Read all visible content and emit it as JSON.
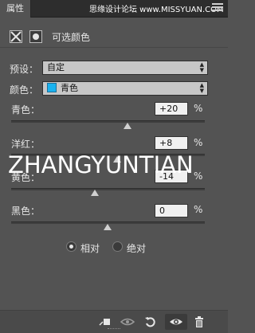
{
  "tab": {
    "label": "属性"
  },
  "watermark_top": "思缘设计论坛 www.MISSYUAN.COM",
  "adjustment": {
    "title": "可选颜色",
    "mask_icon": "layer-mask-icon",
    "type_icon": "selective-color-icon"
  },
  "preset": {
    "label": "预设：",
    "value": "自定"
  },
  "colors": {
    "label": "颜色：",
    "value": "青色",
    "swatch_color": "#19b2ef"
  },
  "sliders": [
    {
      "label": "青色：",
      "value": "+20",
      "unit": "%",
      "level": 20
    },
    {
      "label": "洋红：",
      "value": "+8",
      "unit": "%",
      "level": 8
    },
    {
      "label": "黄色：",
      "value": "-14",
      "unit": "%",
      "level": -14
    },
    {
      "label": "黑色：",
      "value": "0",
      "unit": "%",
      "level": 0
    }
  ],
  "watermark_mid": "ZHANGYUNTIAN",
  "method": {
    "relative_label": "相对",
    "absolute_label": "绝对",
    "selected": "relative"
  },
  "bottom_icons": [
    "clip-to-layer-icon",
    "view-previous-icon",
    "reset-icon",
    "visibility-eye-icon",
    "trash-icon"
  ]
}
